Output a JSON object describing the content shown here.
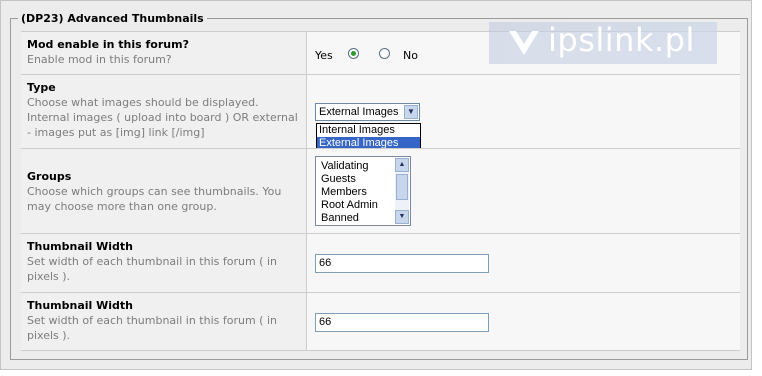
{
  "section_title": "(DP23) Advanced Thumbnails",
  "watermark": {
    "text": "ipslink.pl"
  },
  "settings": [
    {
      "title": "Mod enable in this forum?",
      "description": "Enable mod in this forum?",
      "yes_label": "Yes",
      "no_label": "No",
      "selected": "Yes"
    },
    {
      "title": "Type",
      "description": "Choose what images should be displayed. Internal images ( upload into board ) OR external - images put as [img] link [/img]",
      "selected_value": "External Images",
      "options": [
        "Internal Images",
        "External Images"
      ]
    },
    {
      "title": "Groups",
      "description": "Choose which groups can see thumbnails. You may choose more than one group.",
      "options": [
        "Validating",
        "Guests",
        "Members",
        "Root Admin",
        "Banned"
      ]
    },
    {
      "title": "Thumbnail Width",
      "description": "Set width of each thumbnail in this forum ( in pixels ).",
      "value": "66"
    },
    {
      "title": "Thumbnail Width",
      "description": "Set width of each thumbnail in this forum ( in pixels ).",
      "value": "66"
    }
  ],
  "icons": {
    "dropdown_arrow": "chevron-down-icon",
    "scroll_up": "chevron-up-icon",
    "scroll_down": "chevron-down-icon",
    "watermark_logo": "ipslink-logo-icon"
  },
  "colors": {
    "selected_option_bg": "#3565c7",
    "radio_dot": "#2a9a2a",
    "description_text": "#7d7d7d"
  }
}
